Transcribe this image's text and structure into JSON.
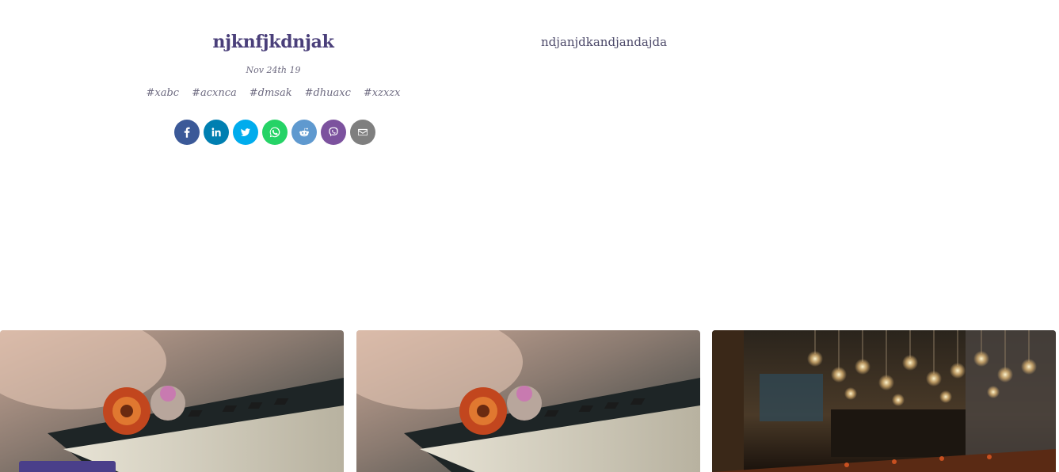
{
  "post": {
    "title": "njknfjkdnjak",
    "date": "Nov 24th 19",
    "body": "ndjanjdkandjandajda",
    "tags": [
      "#xabc",
      "#acxnca",
      "#dmsak",
      "#dhuaxc",
      "#xzxzx"
    ]
  },
  "share": [
    {
      "name": "facebook",
      "icon": "facebook-icon",
      "color": "#3b5998"
    },
    {
      "name": "linkedin",
      "icon": "linkedin-icon",
      "color": "#007fb1"
    },
    {
      "name": "twitter",
      "icon": "twitter-icon",
      "color": "#00aced"
    },
    {
      "name": "whatsapp",
      "icon": "whatsapp-icon",
      "color": "#25d366"
    },
    {
      "name": "reddit",
      "icon": "reddit-icon",
      "color": "#5f99cf"
    },
    {
      "name": "viber",
      "icon": "viber-icon",
      "color": "#7c529e"
    },
    {
      "name": "email",
      "icon": "email-icon",
      "color": "#7f7f7f"
    }
  ],
  "related_cards": [
    {
      "image": "piano-flower-image"
    },
    {
      "image": "piano-flower-image"
    },
    {
      "image": "bar-interior-image"
    }
  ],
  "colors": {
    "accent": "#4a3f7a",
    "badge": "#4a3f8a"
  }
}
